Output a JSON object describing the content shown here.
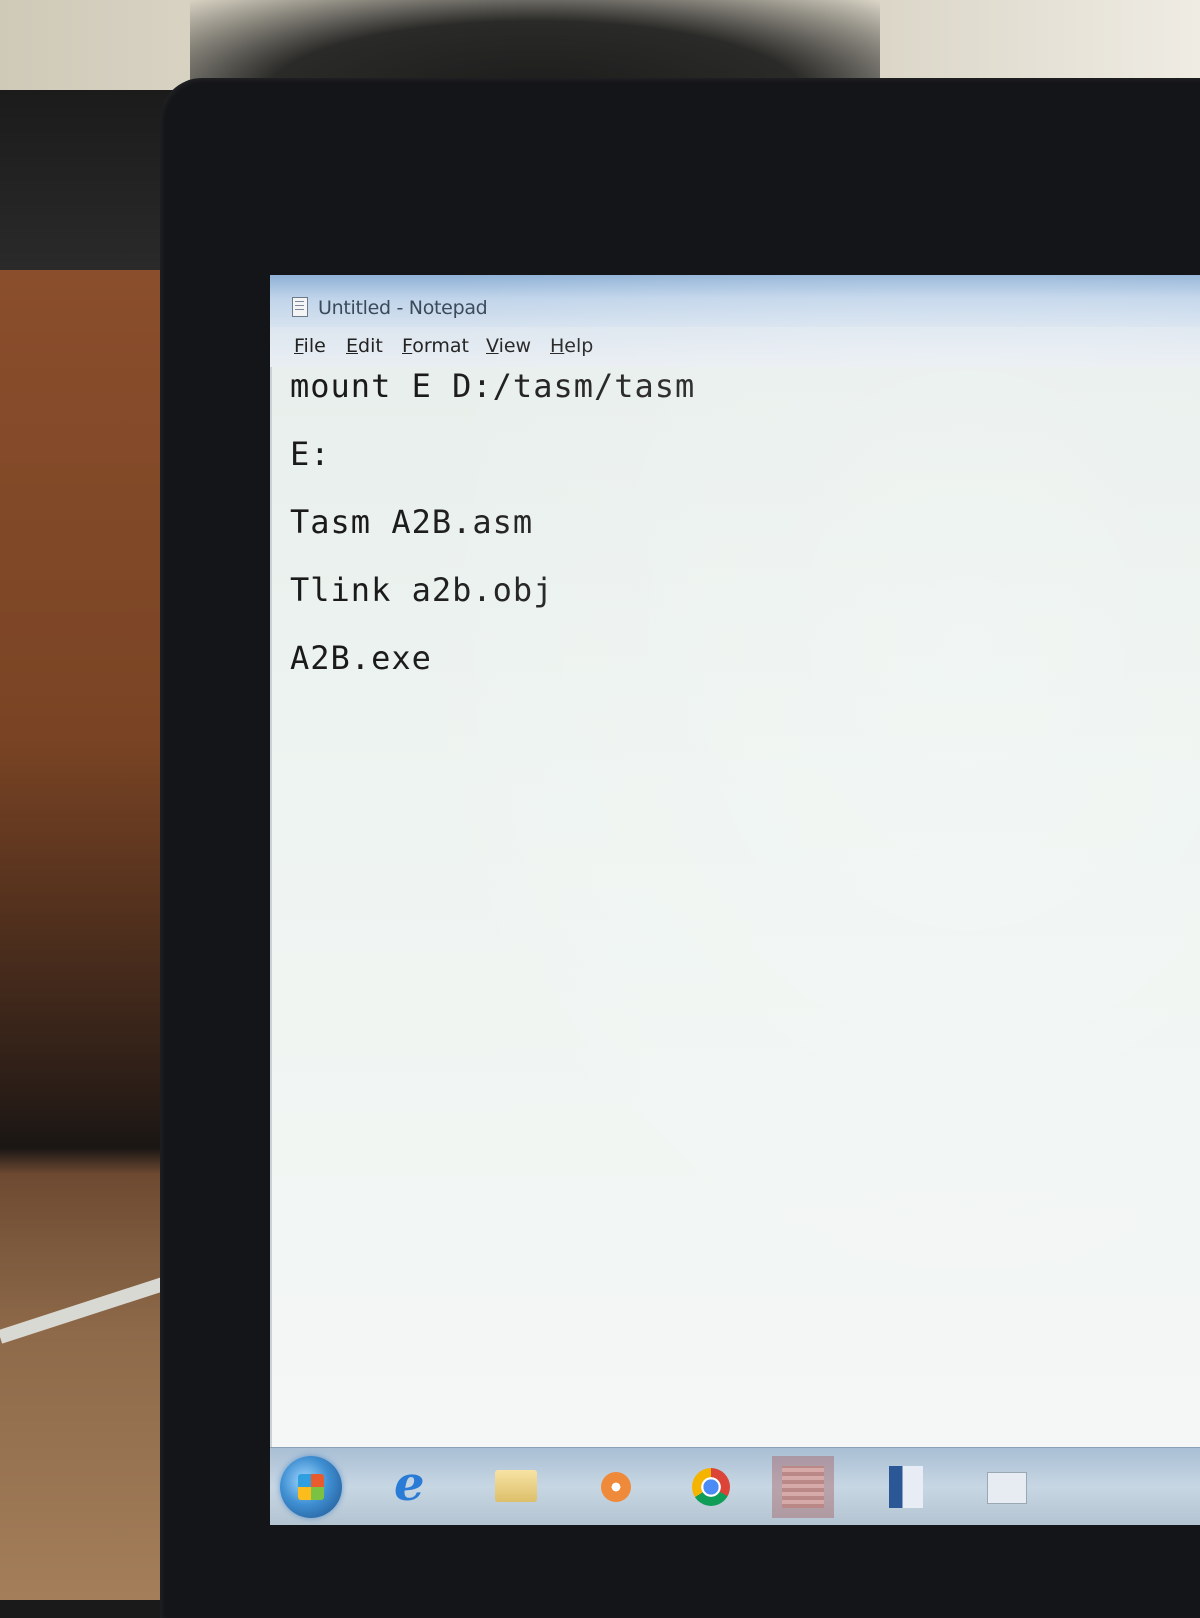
{
  "window": {
    "title": "Untitled - Notepad"
  },
  "menu": {
    "file": "File",
    "edit": "Edit",
    "format": "Format",
    "view": "View",
    "help": "Help"
  },
  "editor": {
    "lines": [
      "mount E D:/tasm/tasm",
      "E:",
      "Tasm A2B.asm",
      "Tlink a2b.obj",
      "A2B.exe"
    ]
  },
  "taskbar": {
    "icons": [
      "windows-start-icon",
      "internet-explorer-icon",
      "folder-icon",
      "media-player-icon",
      "chrome-icon",
      "app-icon",
      "word-icon",
      "explorer-icon"
    ]
  }
}
